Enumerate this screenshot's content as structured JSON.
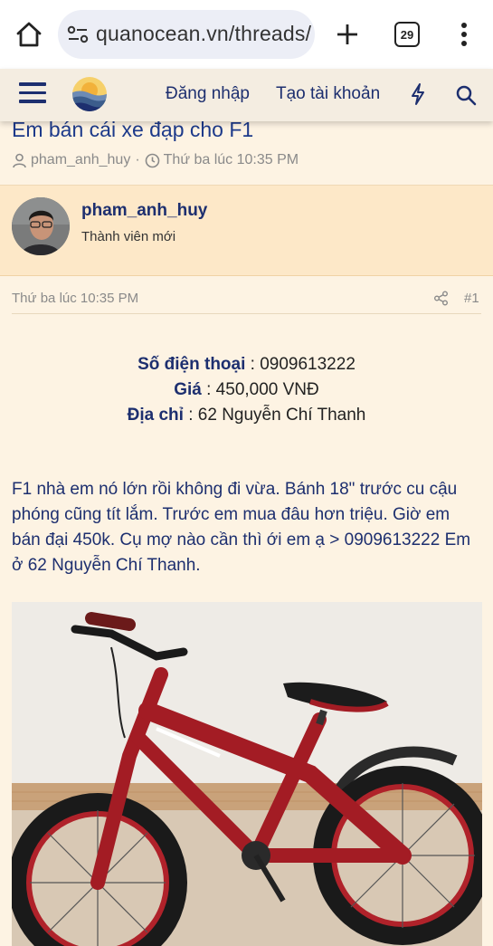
{
  "browser": {
    "url": "quanocean.vn/threads/",
    "tab_count": "29"
  },
  "header": {
    "login_label": "Đăng nhập",
    "register_label": "Tạo tài khoản"
  },
  "thread": {
    "title": "Em bán cái xe đạp cho F1",
    "author": "pham_anh_huy",
    "meta_separator": "·",
    "date": "Thứ ba lúc 10:35 PM"
  },
  "post": {
    "username": "pham_anh_huy",
    "user_title": "Thành viên mới",
    "date": "Thứ ba lúc 10:35 PM",
    "number": "#1",
    "phone_label": "Số điện thoại",
    "phone_value": " : 0909613222",
    "price_label": "Giá",
    "price_value": " : 450,000 VNĐ",
    "address_label": "Địa chỉ",
    "address_value": " : 62 Nguyễn Chí Thanh",
    "body_text": "F1 nhà em nó lớn rồi không đi vừa. Bánh 18\" trước cu cậu phóng cũng tít lắm. Trước em mua đâu hơn triệu. Giờ em bán đại 450k. Cụ mợ nào cần thì ới em ạ > 0909613222 Em ở 62 Nguyễn Chí Thanh."
  },
  "colors": {
    "accent": "#1d2f6f",
    "post_header_bg": "#fde8c8",
    "page_bg": "#fdf3e3"
  }
}
